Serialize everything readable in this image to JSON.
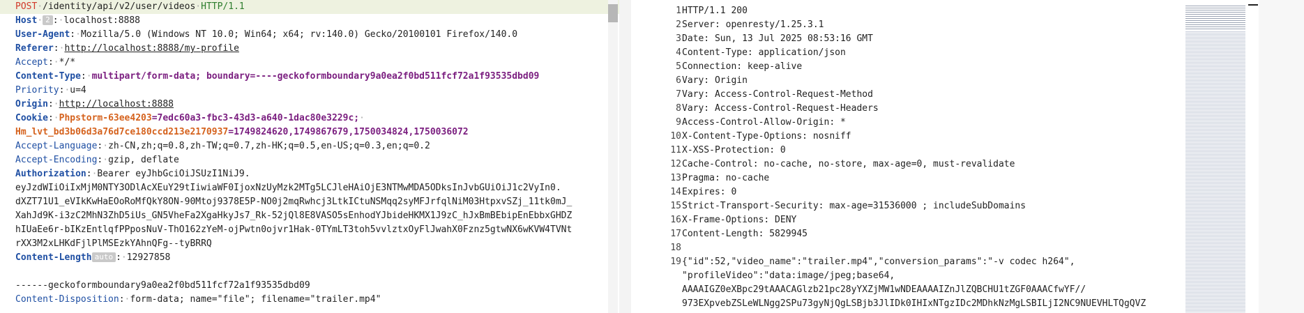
{
  "request": {
    "method": "POST",
    "path": "/identity/api/v2/user/videos",
    "version": "HTTP/1.1",
    "host_badge": "2",
    "host": "localhost:8888",
    "user_agent": "Mozilla/5.0 (Windows NT 10.0; Win64; x64; rv:140.0) Gecko/20100101 Firefox/140.0",
    "referer": "http://localhost:8888/my-profile",
    "accept": "*/*",
    "content_type": "multipart/form-data; boundary=----geckoformboundary9a0ea2f0bd511fcf72a1f93535dbd09",
    "priority": "u=4",
    "origin": "http://localhost:8888",
    "cookie1_name": "Phpstorm-63ee4203",
    "cookie1_value": "7edc60a3-fbc3-43d3-a640-1dac80e3229c;",
    "cookie2_name": "Hm_lvt_bd3b06d3a76d7ce180ccd213e2170937",
    "cookie2_value": "1749824620,1749867679,1750034824,1750036072",
    "accept_language": "zh-CN,zh;q=0.8,zh-TW;q=0.7,zh-HK;q=0.5,en-US;q=0.3,en;q=0.2",
    "accept_encoding": "gzip, deflate",
    "authorization": "Bearer eyJhbGciOiJSUzI1NiJ9.",
    "token_lines": [
      "eyJzdWIiOiIxMjM0NTY3ODlAcXEuY29tIiwiaWF0IjoxNzUyMzk2MTg5LCJleHAiOjE3NTMwMDA5ODksInJvbGUiOiJ1c2VyIn0.",
      "dXZT71U1_eVIkKwHaEOoRoMfQkY8ON-90Mtoj9378E5P-NO0j2mqRwhcj3LtkICtuNSMqq2syMFJrfqlNiM03HtpxvSZj_11tk0mJ_",
      "XahJd9K-i3zC2MhN3ZhD5iUs_GN5VheFa2XgaHkyJs7_Rk-52jQl8E8VASO5sEnhodYJbideHKMX1J9zC_hJxBmBEbipEnEbbxGHDZ",
      "hIUaEe6r-bIKzEntlqfPPposNuV-ThO162zYeM-ojPwtn0ojvr1Hak-0TYmLT3toh5vvlztxOyFlJwahX0Fznz5gtwNX6wKVW4TVNt",
      "rXX3M2xLHKdFjlPlMSEzkYAhnQFg--tyBRRQ"
    ],
    "content_length_badge": "auto",
    "content_length": "12927858",
    "boundary_line": "------geckoformboundary9a0ea2f0bd511fcf72a1f93535dbd09",
    "content_disposition": "form-data; name=\"file\"; filename=\"trailer.mp4\""
  },
  "response": {
    "lines": [
      {
        "n": "1",
        "t": "HTTP/1.1 200"
      },
      {
        "n": "2",
        "t": "Server: openresty/1.25.3.1"
      },
      {
        "n": "3",
        "t": "Date: Sun, 13 Jul 2025 08:53:16 GMT"
      },
      {
        "n": "4",
        "t": "Content-Type: application/json"
      },
      {
        "n": "5",
        "t": "Connection: keep-alive"
      },
      {
        "n": "6",
        "t": "Vary: Origin"
      },
      {
        "n": "7",
        "t": "Vary: Access-Control-Request-Method"
      },
      {
        "n": "8",
        "t": "Vary: Access-Control-Request-Headers"
      },
      {
        "n": "9",
        "t": "Access-Control-Allow-Origin: *"
      },
      {
        "n": "10",
        "t": "X-Content-Type-Options: nosniff"
      },
      {
        "n": "11",
        "t": "X-XSS-Protection: 0"
      },
      {
        "n": "12",
        "t": "Cache-Control: no-cache, no-store, max-age=0, must-revalidate"
      },
      {
        "n": "13",
        "t": "Pragma: no-cache"
      },
      {
        "n": "14",
        "t": "Expires: 0"
      },
      {
        "n": "15",
        "t": "Strict-Transport-Security: max-age=31536000 ; includeSubDomains"
      },
      {
        "n": "16",
        "t": "X-Frame-Options: DENY"
      },
      {
        "n": "17",
        "t": "Content-Length: 5829945"
      },
      {
        "n": "18",
        "t": ""
      },
      {
        "n": "19",
        "t": "{\"id\":52,\"video_name\":\"trailer.mp4\",\"conversion_params\":\"-v codec h264\","
      },
      {
        "n": "",
        "t": "\"profileVideo\":\"data:image/jpeg;base64,"
      },
      {
        "n": "",
        "t": "AAAAIGZ0eXBpc29tAAACAGlzb21pc28yYXZjMW1wNDEAAAAIZnJlZQBCHU1tZGF0AAACfwYF//"
      },
      {
        "n": "",
        "t": "973EXpvebZSLeWLNgg2SPu73gyNjQgLSBjb3JlIDk0IHIxNTgzIDc2MDhkNzMgLSBILjI2NC9NUEVHLTQgQVZ"
      }
    ]
  }
}
